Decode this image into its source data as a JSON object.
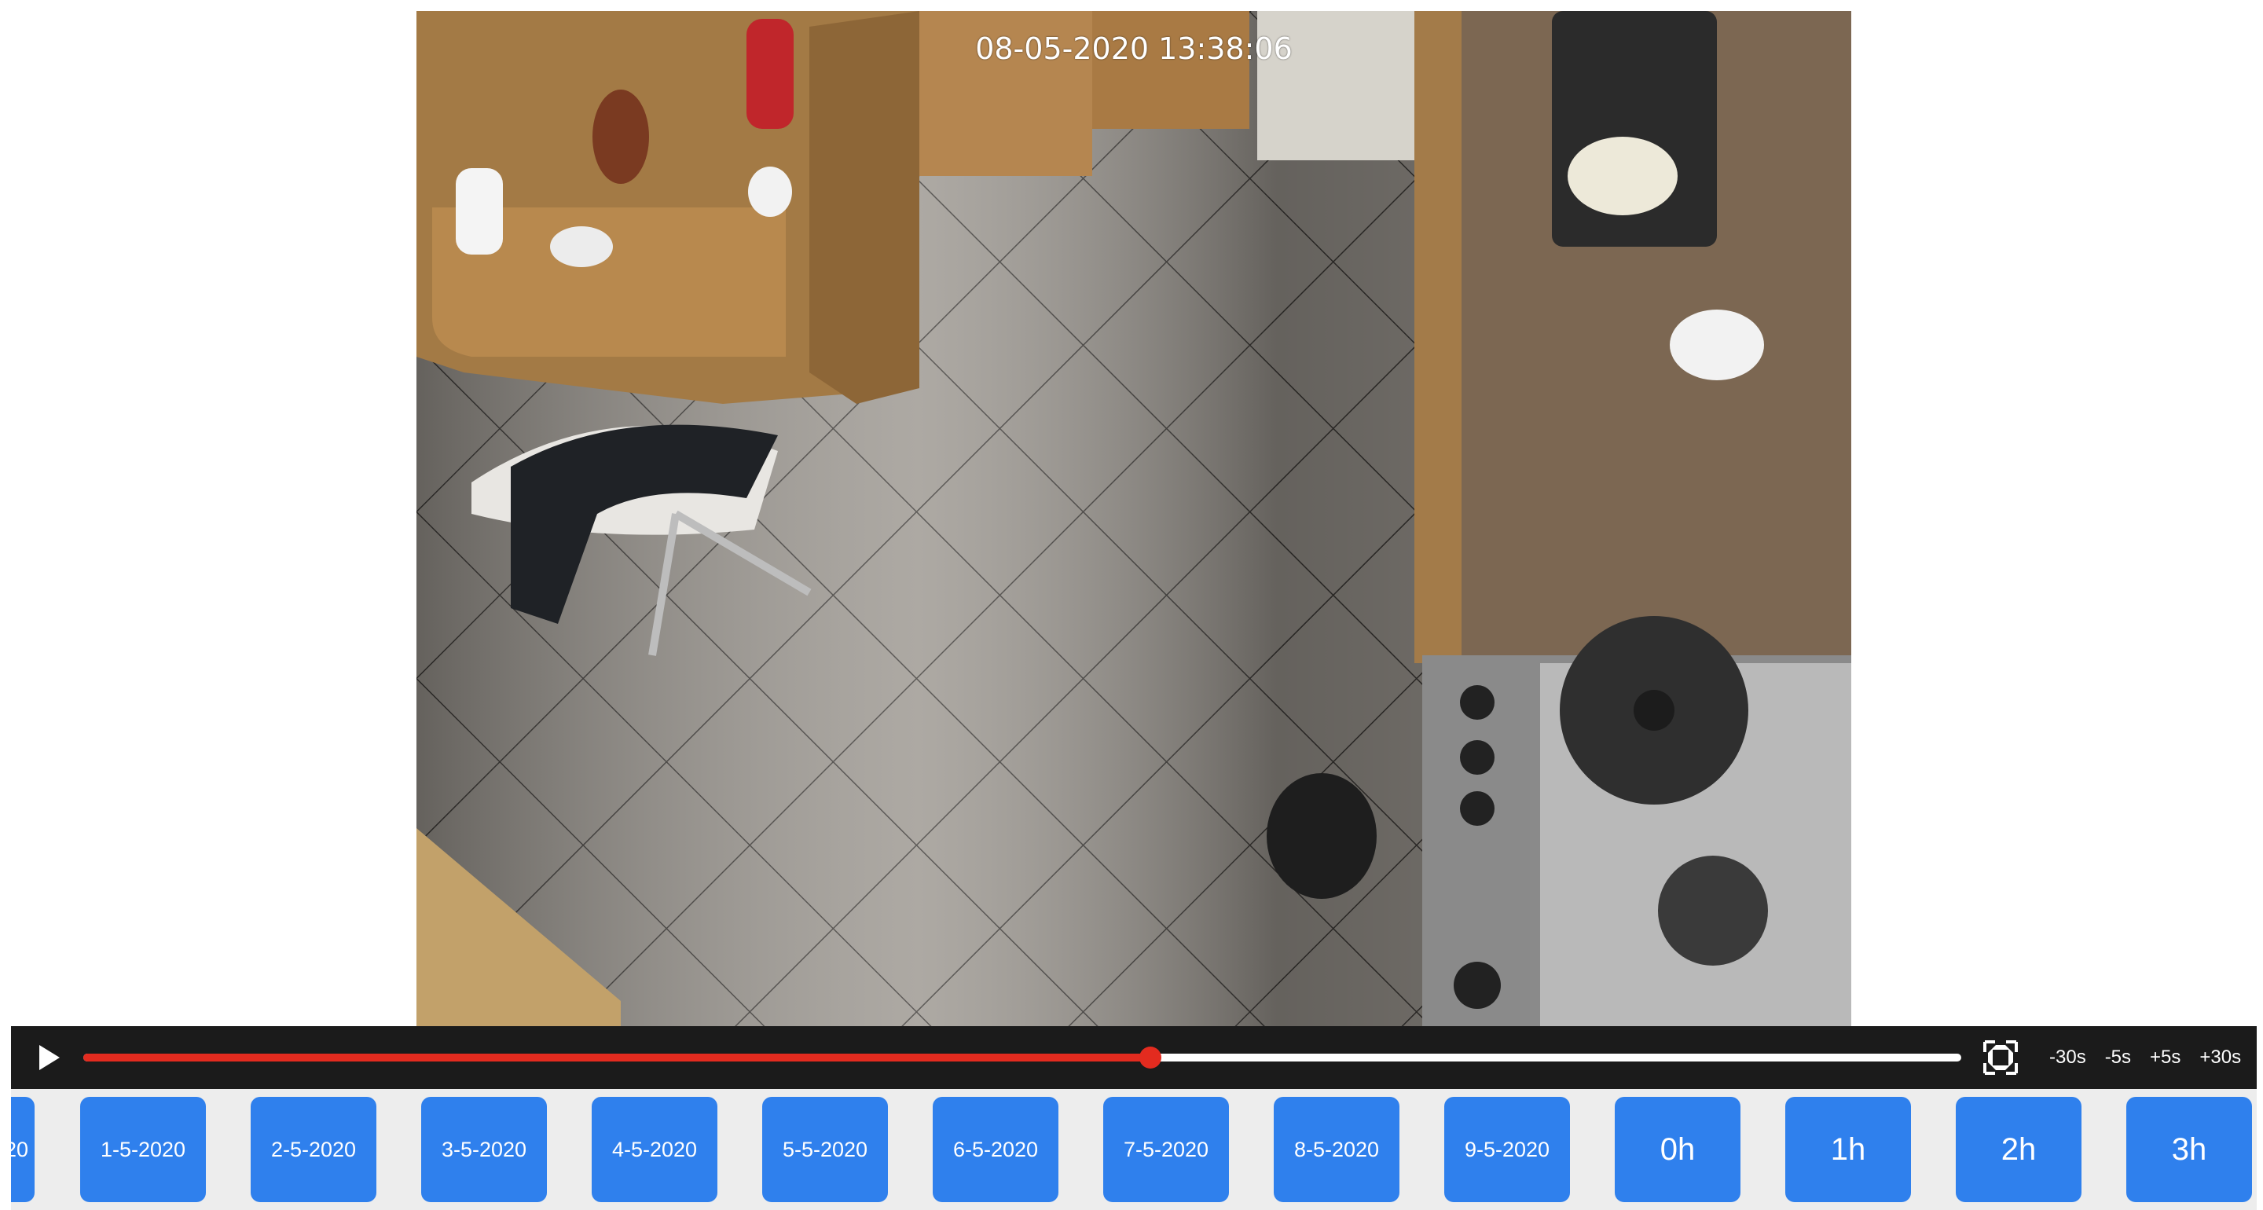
{
  "video": {
    "timestamp": "08-05-2020  13:38:06"
  },
  "controls": {
    "progress_percent": 56.8,
    "seek_buttons": [
      {
        "label": "-30s"
      },
      {
        "label": "-5s"
      },
      {
        "label": "+5s"
      },
      {
        "label": "+30s"
      }
    ]
  },
  "date_strip": {
    "partial_label": "20",
    "dates": [
      {
        "label": "1-5-2020"
      },
      {
        "label": "2-5-2020"
      },
      {
        "label": "3-5-2020"
      },
      {
        "label": "4-5-2020"
      },
      {
        "label": "5-5-2020"
      },
      {
        "label": "6-5-2020"
      },
      {
        "label": "7-5-2020"
      },
      {
        "label": "8-5-2020"
      },
      {
        "label": "9-5-2020"
      }
    ],
    "hours": [
      {
        "label": "0h"
      },
      {
        "label": "1h"
      },
      {
        "label": "2h"
      },
      {
        "label": "3h"
      }
    ]
  },
  "colors": {
    "accent_button": "#2f80ed",
    "progress": "#e32b1f",
    "control_bar": "#1b1b1b"
  }
}
